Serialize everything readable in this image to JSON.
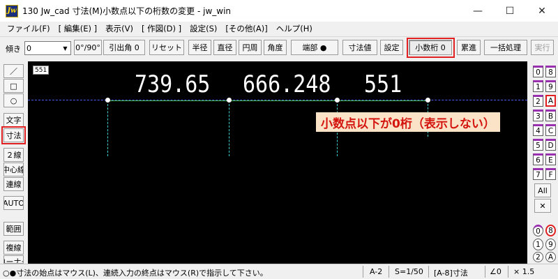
{
  "window": {
    "icon_label": "Jw",
    "title": "130 Jw_cad 寸法(M)小数点以下の桁数の変更 - jw_win",
    "controls": [
      "—",
      "☐",
      "✕"
    ]
  },
  "menu": [
    "ファイル(F)",
    "[ 編集(E) ]",
    "表示(V)",
    "[ 作図(D) ]",
    "設定(S)",
    "[その他(A)]",
    "ヘルプ(H)"
  ],
  "toolbar": {
    "tilt_label": "傾き",
    "tilt_value": "0",
    "angle_button": "0°/90°",
    "leader_angle": "引出角 0",
    "reset": "リセット",
    "radius": "半径",
    "diameter": "直径",
    "circumference": "円周",
    "angle": "角度",
    "endpoint": "端部 ●",
    "dim_value": "寸法値",
    "settings": "設定",
    "decimal_digits": "小数桁 0",
    "cumulative": "累進",
    "batch": "一括処理",
    "execute": "実行"
  },
  "left_tools": [
    "／",
    "□",
    "○",
    "文字",
    "寸法",
    "２線",
    "中心線",
    "連線",
    "AUTO",
    "範囲",
    "複線",
    "コーナー"
  ],
  "canvas": {
    "layer_tag": "551",
    "dims": [
      "739.65",
      "666.248",
      "551"
    ],
    "callout": "小数点以下が0桁（表示しない）"
  },
  "layers": {
    "left": [
      "0",
      "1",
      "2",
      "3",
      "4",
      "5",
      "6",
      "7"
    ],
    "right": [
      "8",
      "9",
      "A",
      "B",
      "C",
      "D",
      "E",
      "F"
    ],
    "all": "All",
    "cross": "✕",
    "groups_left": [
      "0",
      "1",
      "2"
    ],
    "groups_right": [
      "8",
      "9",
      "A"
    ]
  },
  "status": {
    "message": "○●寸法の始点はマウス(L)、連続入力の終点はマウス(R)で指示して下さい。",
    "paper": "A-2",
    "scale": "S=1/50",
    "layer": "[A-8]寸法",
    "angle": "∠0",
    "factor": "× 1.5"
  }
}
